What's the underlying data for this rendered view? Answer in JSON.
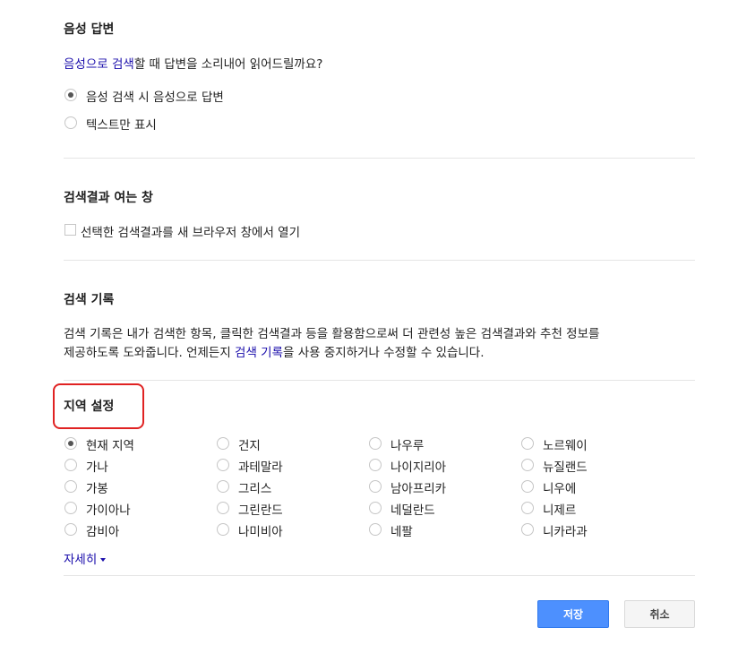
{
  "voice": {
    "title": "음성 답변",
    "question_link": "음성으로 검색",
    "question_rest": "할 때 답변을 소리내어 읽어드릴까요?",
    "options": [
      {
        "label": "음성 검색 시 음성으로 답변",
        "selected": true
      },
      {
        "label": "텍스트만 표시",
        "selected": false
      }
    ]
  },
  "results_window": {
    "title": "검색결과 여는 창",
    "checkbox_label": "선택한 검색결과를 새 브라우저 창에서 열기",
    "checked": false
  },
  "history": {
    "title": "검색 기록",
    "desc_line1": "검색 기록은 내가 검색한 항목, 클릭한 검색결과 등을 활용함으로써 더 관련성 높은 검색결과와 추천 정보를",
    "desc_line2_pre": "제공하도록 도와줍니다. 언제든지 ",
    "desc_line2_link": "검색 기록",
    "desc_line2_post": "을 사용 중지하거나 수정할 수 있습니다."
  },
  "region": {
    "title": "지역 설정",
    "columns": [
      [
        "현재 지역",
        "가나",
        "가봉",
        "가이아나",
        "감비아"
      ],
      [
        "건지",
        "과테말라",
        "그리스",
        "그린란드",
        "나미비아"
      ],
      [
        "나우루",
        "나이지리아",
        "남아프리카",
        "네덜란드",
        "네팔"
      ],
      [
        "노르웨이",
        "뉴질랜드",
        "니우에",
        "니제르",
        "니카라과"
      ]
    ],
    "selected": "현재 지역",
    "more_label": "자세히"
  },
  "buttons": {
    "save": "저장",
    "cancel": "취소"
  },
  "colors": {
    "link": "#1a0dab",
    "save_button": "#4d90fe",
    "highlight_border": "#e02222"
  }
}
